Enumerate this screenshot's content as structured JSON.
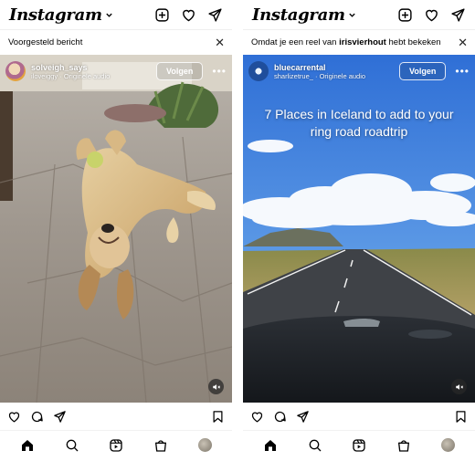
{
  "app": {
    "logo": "Instagram"
  },
  "left": {
    "banner": {
      "text": "Voorgesteld bericht"
    },
    "post": {
      "username": "solveigh_says",
      "subtitle": "iloveiggy · Originele audio",
      "follow_label": "Volgen"
    }
  },
  "right": {
    "banner": {
      "prefix": "Omdat je een reel van ",
      "user": "irisvierhout",
      "suffix": " hebt bekeken"
    },
    "post": {
      "username": "bluecarrental",
      "subtitle": "sharlizetrue_ · Originele audio",
      "follow_label": "Volgen",
      "overlay": "7 Places in Iceland to add to your ring road roadtrip"
    }
  },
  "colors": {
    "text": "#000000",
    "overlay_text": "#ffffff",
    "background": "#ffffff"
  },
  "icons": [
    "chevron-down-icon",
    "new-post-icon",
    "heart-icon",
    "send-icon",
    "close-icon",
    "more-icon",
    "mute-icon",
    "comment-icon",
    "share-icon",
    "save-icon",
    "home-icon",
    "search-icon",
    "reels-icon",
    "shop-icon"
  ]
}
